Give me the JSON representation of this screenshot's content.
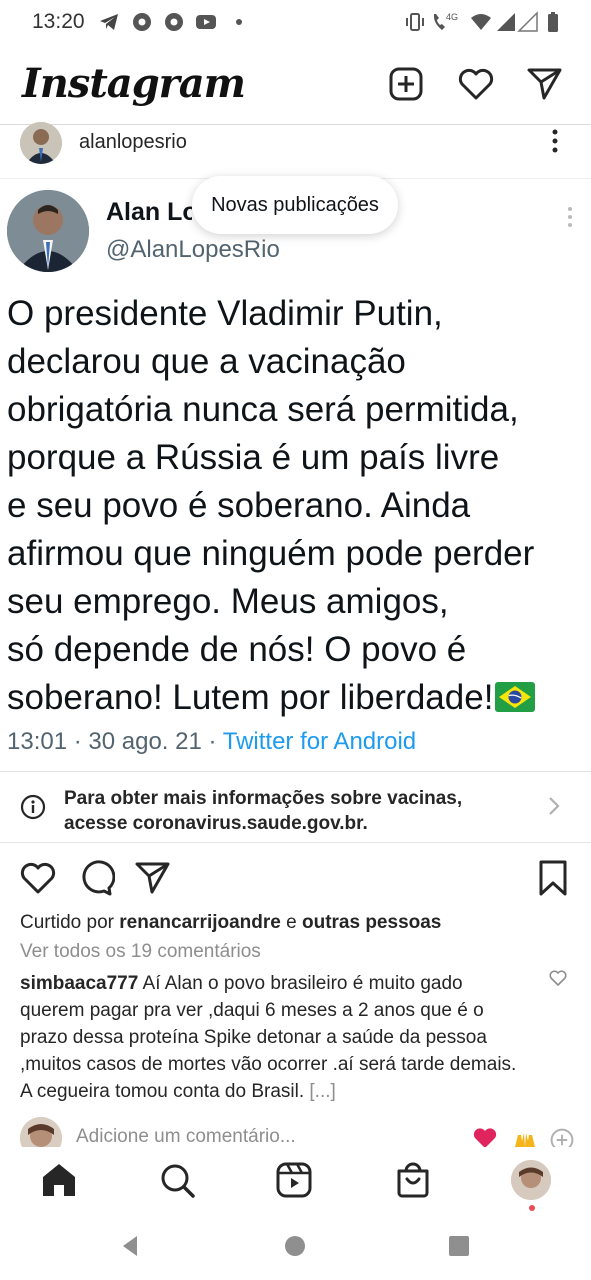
{
  "status_bar": {
    "time": "13:20",
    "network": "4G",
    "icons": [
      "telegram-icon",
      "chrome-icon",
      "chrome-icon",
      "youtube-icon",
      "dot-icon",
      "vibrate-icon",
      "call-icon",
      "wifi-icon",
      "signal-icon",
      "signal-empty-icon",
      "battery-icon"
    ]
  },
  "header": {
    "logo": "Instagram",
    "icons": [
      "new-post-icon",
      "activity-heart-icon",
      "direct-message-icon"
    ]
  },
  "post": {
    "username": "alanlopesrio",
    "tweet": {
      "name": "Alan Lopes",
      "handle": "@AlanLopesRio",
      "text": "O presidente Vladimir Putin,\ndeclarou que a vacinação\nobrigatória nunca será permitida,\nporque a Rússia é um país livre\ne seu povo é soberano. Ainda\nafirmou que ninguém pode perder\nseu emprego. Meus amigos,\nsó depende de nós! O povo é\nsoberano! Lutem por liberdade!",
      "time": "13:01",
      "date": "30 ago. 21",
      "source": "Twitter for Android",
      "separator": " · "
    },
    "toast": "Novas publicações",
    "info_banner": "Para obter mais informações sobre vacinas,\nacesse coronavirus.saude.gov.br.",
    "liked_by_prefix": "Curtido por ",
    "liked_by_user": "renancarrijoandre",
    "liked_by_and": " e ",
    "liked_by_others": "outras pessoas",
    "view_comments": "Ver todos os 19 comentários",
    "comment": {
      "user": "simbaaca777",
      "text": " Aí Alan o povo brasileiro é muito gado querem pagar pra ver ,daqui 6 meses a 2 anos que é o prazo dessa proteína Spike detonar a saúde da pessoa ,muitos casos de mortes vão ocorrer .aí será tarde demais. A cegueira tomou conta do Brasil.",
      "more": " [...]"
    },
    "add_comment_placeholder": "Adicione um comentário...",
    "quick_emojis": [
      "❤️",
      "🙌"
    ]
  },
  "bottom_nav": [
    "home-icon",
    "search-icon",
    "reels-icon",
    "shop-icon",
    "profile-avatar"
  ],
  "colors": {
    "twitter_link": "#1d9bf0",
    "muted": "#8e8e8e",
    "like_red": "#ed4956"
  }
}
